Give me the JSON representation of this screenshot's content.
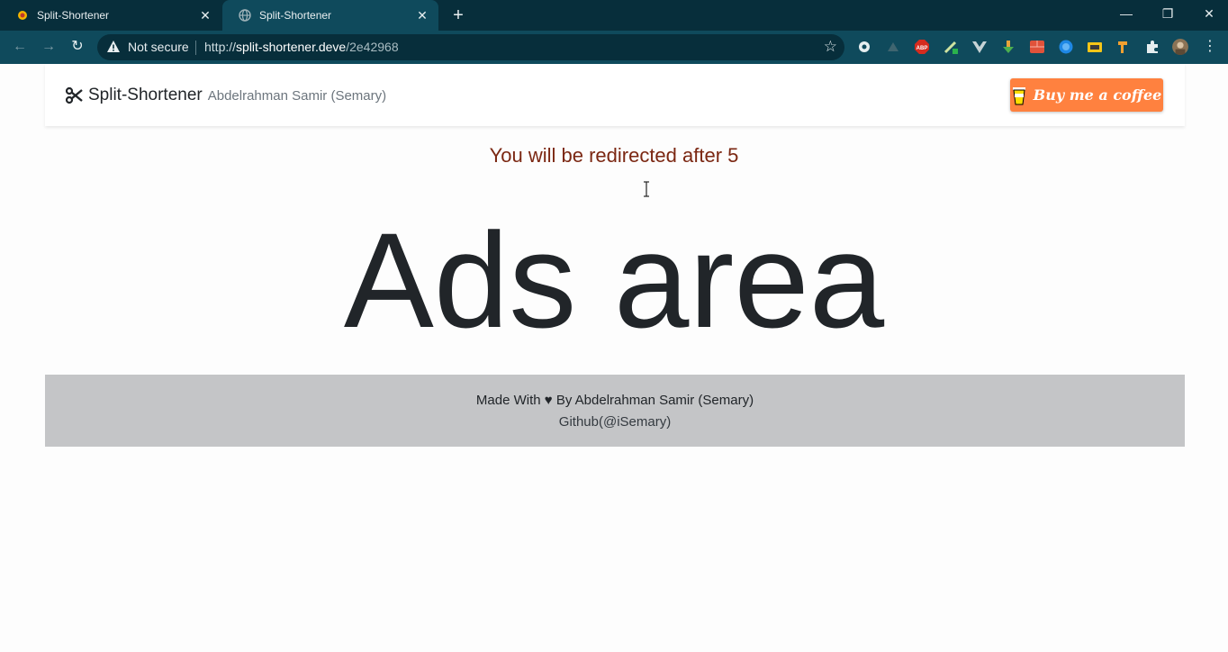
{
  "browser": {
    "tabs": [
      {
        "title": "Split-Shortener",
        "active": false
      },
      {
        "title": "Split-Shortener",
        "active": true
      }
    ],
    "address": {
      "security_label": "Not secure",
      "scheme": "http://",
      "host": "split-shortener.deve",
      "path": "/2e42968"
    }
  },
  "navbar": {
    "brand_name": "Split-Shortener",
    "brand_author": "Abdelrahman Samir (Semary)",
    "coffee_button_label": "Buy me a coffee"
  },
  "main": {
    "redirect_text": "You will be redirected after 5",
    "ads_text": "Ads area"
  },
  "footer": {
    "line1": "Made With ♥ By Abdelrahman Samir (Semary)",
    "line2": "Github(@iSemary)"
  }
}
